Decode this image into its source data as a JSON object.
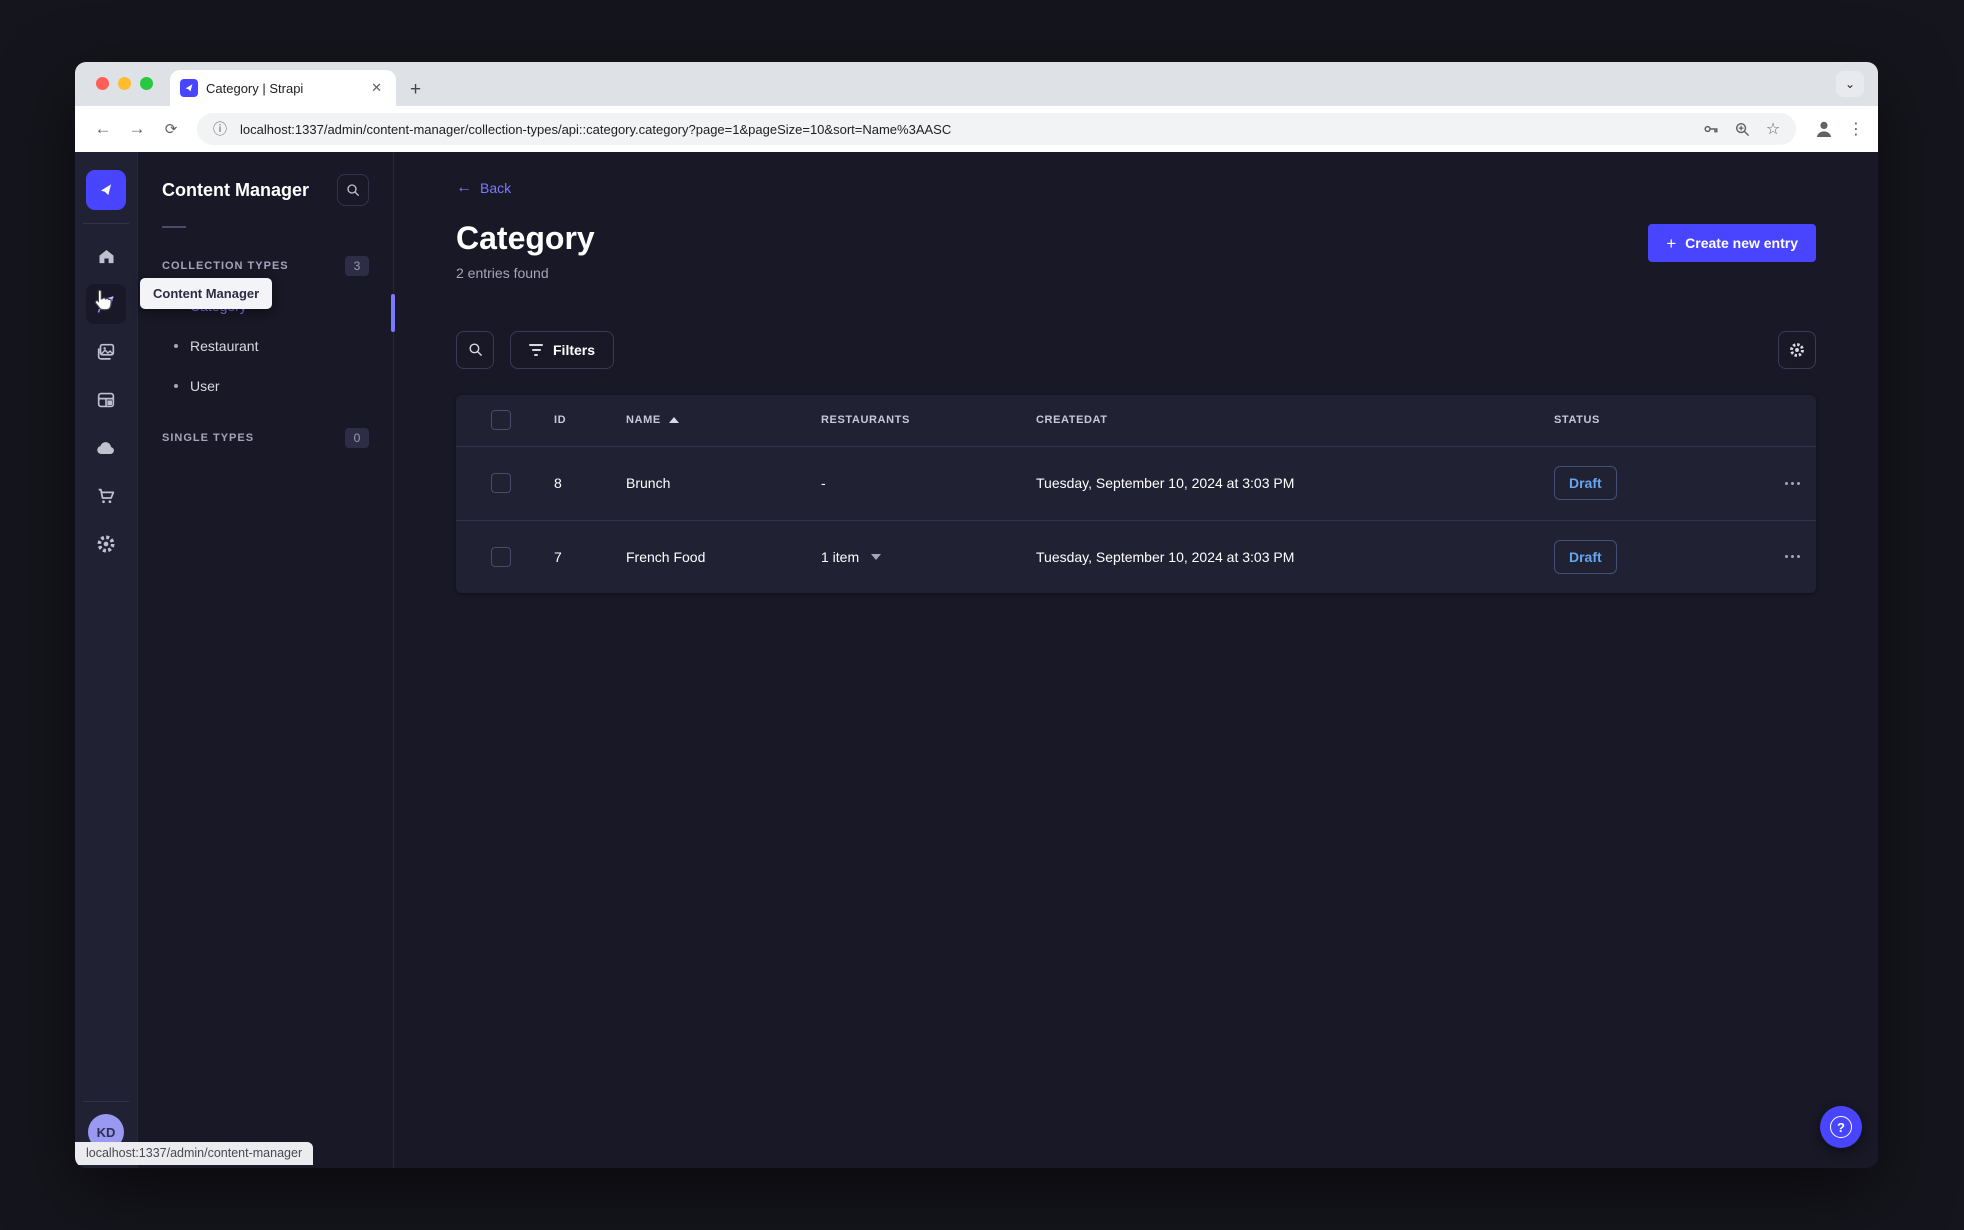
{
  "colors": {
    "accent": "#4945ff",
    "accent_light": "#7b79ff",
    "draft_text": "#66a5f0",
    "surface": "#212134",
    "background": "#181826",
    "border": "#32324d",
    "traffic_red": "#ff5f57",
    "traffic_yellow": "#febc2e",
    "traffic_green": "#28c840"
  },
  "browser": {
    "tab_title": "Category | Strapi",
    "url": "localhost:1337/admin/content-manager/collection-types/api::category.category?page=1&pageSize=10&sort=Name%3AASC",
    "status_link_preview": "localhost:1337/admin/content-manager"
  },
  "sidebar": {
    "tooltip": "Content Manager",
    "avatar_initials": "KD",
    "icons": [
      "strapi-logo",
      "home-icon",
      "content-manager-icon",
      "media-library-icon",
      "content-type-builder-icon",
      "cloud-icon",
      "marketplace-icon",
      "settings-icon"
    ]
  },
  "subnav": {
    "title": "Content Manager",
    "collection_section": {
      "label": "Collection Types",
      "badge": "3"
    },
    "items": [
      {
        "label": "Category",
        "active": true
      },
      {
        "label": "Restaurant",
        "active": false
      },
      {
        "label": "User",
        "active": false
      }
    ],
    "single_section": {
      "label": "Single Types",
      "badge": "0"
    }
  },
  "main": {
    "back": "Back",
    "title": "Category",
    "entries_count": "2 entries found",
    "create_button": "Create new entry",
    "filters_button": "Filters",
    "table": {
      "headers": {
        "id": "ID",
        "name": "NAME",
        "restaurants": "RESTAURANTS",
        "created_at": "CREATEDAT",
        "status": "STATUS"
      },
      "rows": [
        {
          "id": "8",
          "name": "Brunch",
          "restaurants": "-",
          "created_at": "Tuesday, September 10, 2024 at 3:03 PM",
          "status": "Draft",
          "restaurants_expandable": false
        },
        {
          "id": "7",
          "name": "French Food",
          "restaurants": "1 item",
          "created_at": "Tuesday, September 10, 2024 at 3:03 PM",
          "status": "Draft",
          "restaurants_expandable": true
        }
      ]
    }
  }
}
